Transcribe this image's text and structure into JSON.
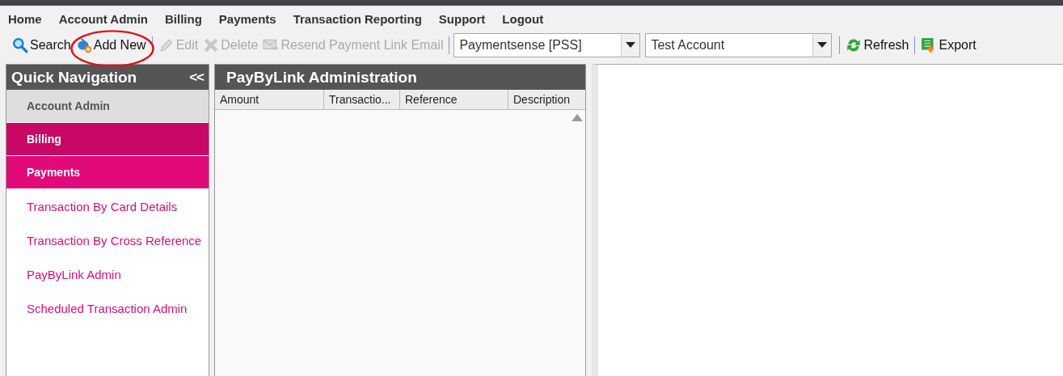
{
  "menu": [
    "Home",
    "Account Admin",
    "Billing",
    "Payments",
    "Transaction Reporting",
    "Support",
    "Logout"
  ],
  "toolbar": [
    {
      "kind": "search",
      "label": "Search",
      "disabled": false,
      "highlighted": false
    },
    {
      "kind": "add",
      "label": "Add New",
      "disabled": false,
      "highlighted": true
    },
    {
      "kind": "separator"
    },
    {
      "kind": "edit",
      "label": "Edit",
      "disabled": true,
      "highlighted": false
    },
    {
      "kind": "delete",
      "label": "Delete",
      "disabled": true,
      "highlighted": false
    },
    {
      "kind": "resend",
      "label": "Resend Payment Link Email",
      "disabled": true,
      "highlighted": false
    },
    {
      "kind": "separator"
    },
    {
      "kind": "dropdown",
      "value": "Paymentsense [PSS]"
    },
    {
      "kind": "dropdown",
      "value": "Test Account"
    },
    {
      "kind": "separator"
    },
    {
      "kind": "refresh",
      "label": "Refresh",
      "disabled": false,
      "highlighted": false
    },
    {
      "kind": "separator"
    },
    {
      "kind": "export",
      "label": "Export",
      "disabled": false,
      "highlighted": false
    }
  ],
  "sidebar": {
    "title": "Quick Navigation",
    "collapse": "<<",
    "items": [
      {
        "kind": "group",
        "label": "Account Admin",
        "selected": false,
        "expanded": false
      },
      {
        "kind": "group",
        "label": "Billing",
        "selected": true,
        "expanded": true
      },
      {
        "kind": "group",
        "label": "Payments",
        "selected": false,
        "expanded": true
      },
      {
        "kind": "link",
        "label": "Transaction By Card Details"
      },
      {
        "kind": "link",
        "label": "Transaction By Cross Reference"
      },
      {
        "kind": "link",
        "label": "PayByLink Admin"
      },
      {
        "kind": "link",
        "label": "Scheduled Transaction Admin"
      }
    ]
  },
  "panel": {
    "title": "PayByLink Administration",
    "columns": [
      "Amount",
      "Transactio...",
      "Reference",
      "Description"
    ]
  }
}
